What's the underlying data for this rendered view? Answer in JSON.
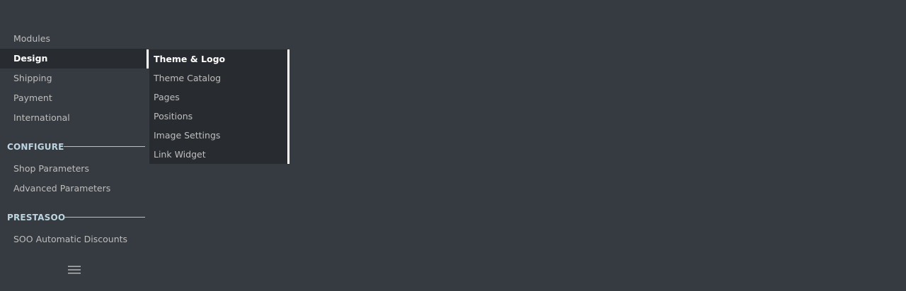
{
  "sidebar": {
    "items_top": [
      {
        "label": "Modules"
      },
      {
        "label": "Design",
        "active": true
      },
      {
        "label": "Shipping"
      },
      {
        "label": "Payment"
      },
      {
        "label": "International"
      }
    ],
    "section_configure": {
      "title": "CONFIGURE",
      "items": [
        {
          "label": "Shop Parameters"
        },
        {
          "label": "Advanced Parameters"
        }
      ]
    },
    "section_prestasoo": {
      "title": "PRESTASOO",
      "items": [
        {
          "label": "SOO Automatic Discounts"
        }
      ]
    },
    "collapse_icon": "hamburger-icon"
  },
  "submenu": {
    "parent": "Design",
    "items": [
      {
        "label": "Theme & Logo",
        "active": true
      },
      {
        "label": "Theme Catalog"
      },
      {
        "label": "Pages"
      },
      {
        "label": "Positions"
      },
      {
        "label": "Image Settings"
      },
      {
        "label": "Link Widget"
      }
    ]
  },
  "colors": {
    "background": "#363a41",
    "active_background": "#282b30",
    "text": "#bebebe",
    "active_text": "#ffffff",
    "section_title": "#bcd6e0"
  }
}
